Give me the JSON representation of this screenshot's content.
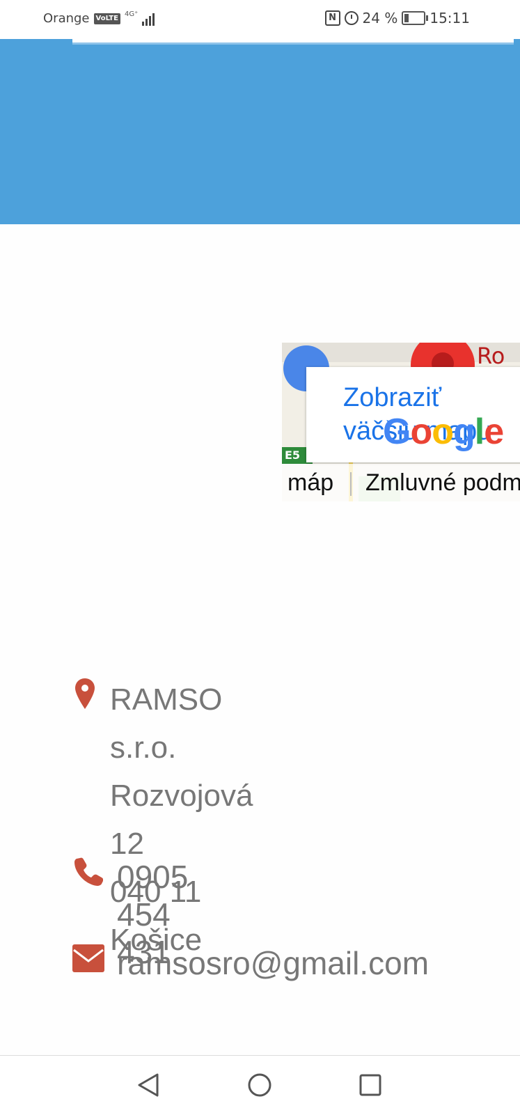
{
  "status_bar": {
    "carrier": "Orange",
    "volte": "VoLTE",
    "network": "4G⁺",
    "battery_text": "24 %",
    "battery_level": 0.24,
    "time": "15:11"
  },
  "map": {
    "link_line1": "Zobraziť",
    "link_line2": "väčšiu mapu",
    "road_label": "E5",
    "place_label": "Ro",
    "footer_left": "máp",
    "footer_right": "Zmluvné podm",
    "logo": [
      "G",
      "o",
      "o",
      "g",
      "l",
      "e"
    ]
  },
  "contact": {
    "company": "RAMSO s.r.o.",
    "street": "Rozvojová 12",
    "city": "040 11 Košice",
    "phone": "0905 454 431",
    "email": "ramsosro@gmail.com"
  },
  "colors": {
    "banner": "#4da1db",
    "icon_accent": "#c8503c",
    "text_gray": "#777777"
  }
}
